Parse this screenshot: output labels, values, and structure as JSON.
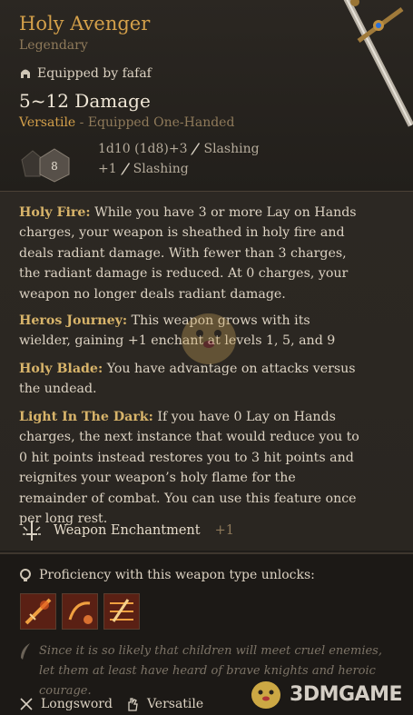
{
  "item": {
    "title": "Holy Avenger",
    "rarity": "Legendary",
    "equipped_by": "Equipped by fafaf",
    "damage": "5~12 Damage",
    "versatile_label": "Versatile",
    "equip_state": " - Equipped One-Handed",
    "die_value": "8",
    "damage_lines": [
      {
        "text": "1d10 (1d8)+3",
        "type": "Slashing"
      },
      {
        "text": "+1",
        "type": "Slashing"
      }
    ]
  },
  "abilities": [
    {
      "name": "Holy Fire:",
      "text": " While you have 3 or more Lay on Hands charges, your weapon is sheathed in holy fire and deals radiant damage. With fewer than 3 charges, the radiant damage is reduced. At 0 charges, your weapon no longer deals radiant damage."
    },
    {
      "name": "Heros Journey:",
      "text": " This weapon grows with its wielder, gaining +1 enchant at levels 1, 5, and 9"
    },
    {
      "name": "Holy Blade:",
      "text": " You have advantage on attacks versus the undead."
    },
    {
      "name": "Light In The Dark:",
      "text": " If you have 0 Lay on Hands charges, the next instance that would reduce you to 0 hit points instead restores you to 3 hit points and reignites your weapon’s holy flame for the remainder of combat. You can use this feature once per long rest."
    }
  ],
  "enchantment": {
    "label": "Weapon Enchantment",
    "value": "+1"
  },
  "proficiency": {
    "label": "Proficiency with this weapon type unlocks:"
  },
  "quote": "Since it is so likely that children will meet cruel enemies, let them at least have heard of brave knights and heroic courage.",
  "properties": [
    {
      "label": "Longsword"
    },
    {
      "label": "Versatile"
    }
  ],
  "watermark": {
    "text": "3DMGAME"
  },
  "colors": {
    "accent": "#d4a04a",
    "panel": "#2c2823",
    "muted": "#8f7a5a"
  }
}
